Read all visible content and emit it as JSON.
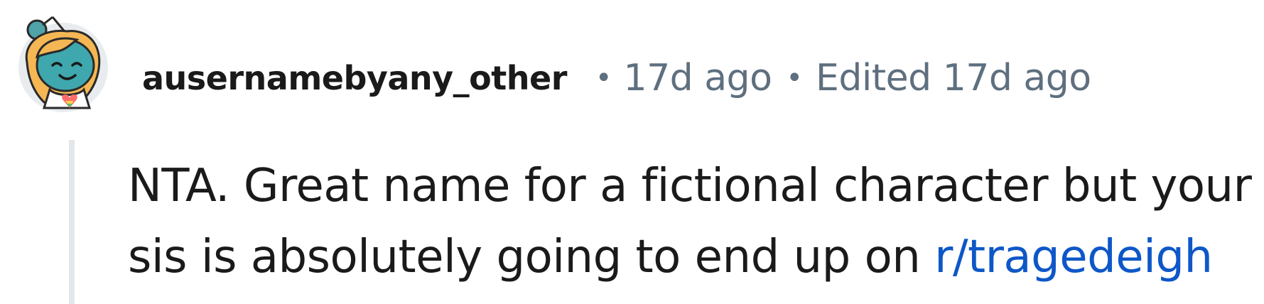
{
  "comment": {
    "author": "ausernamebyany_other",
    "separator": "•",
    "age": "17d ago",
    "edited": "Edited 17d ago",
    "body_line_1": "NTA. Great name for a fictional character but your",
    "body_line_2_prefix": "sis is absolutely going to end up on ",
    "body_link": "r/tragedeigh",
    "link_color": "#0e57c8",
    "text_color": "#1a1a1b",
    "meta_color": "#5e6f7f",
    "avatar_icon": "snoo-avatar-icon"
  }
}
